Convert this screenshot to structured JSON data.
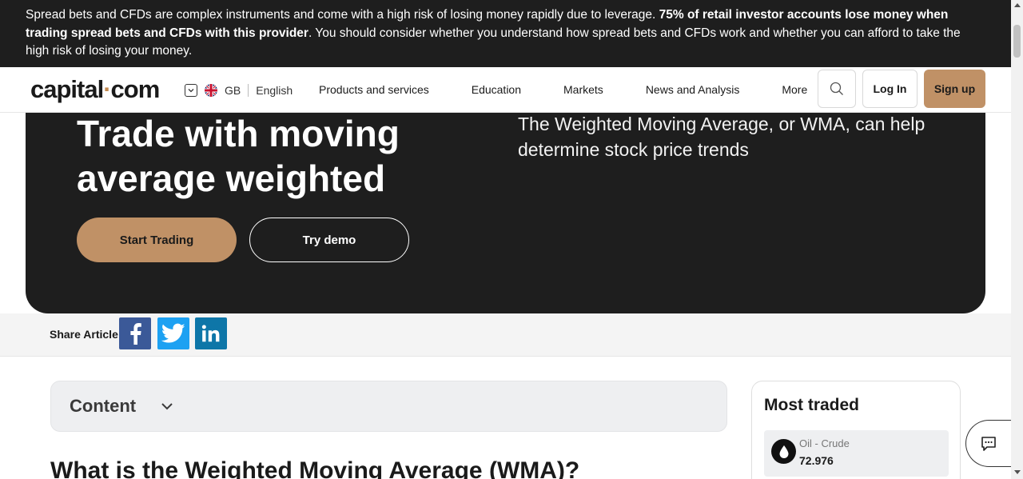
{
  "risk_warning": {
    "text_before": "Spread bets and CFDs are complex instruments and come with a high risk of losing money rapidly due to leverage. ",
    "bold": "75% of retail investor accounts lose money when trading spread bets and CFDs with this provider",
    "text_after": ". You should consider whether you understand how spread bets and CFDs work and whether you can afford to take the high risk of losing your money."
  },
  "header": {
    "logo_main": "capital",
    "logo_dot": "·",
    "logo_end": "com",
    "country": "GB",
    "language": "English",
    "nav": [
      "Products and services",
      "Education",
      "Markets",
      "News and Analysis",
      "More"
    ],
    "login_label": "Log In",
    "signup_label": "Sign up"
  },
  "hero": {
    "title": "Trade with moving average weighted",
    "description": "The Weighted Moving Average, or WMA, can help determine stock price trends",
    "start_label": "Start Trading",
    "demo_label": "Try demo"
  },
  "share": {
    "label": "Share Article",
    "buttons": [
      "facebook",
      "twitter",
      "linkedin"
    ]
  },
  "content": {
    "label": "Content"
  },
  "article": {
    "heading": "What is the Weighted Moving Average (WMA)?"
  },
  "most_traded": {
    "title": "Most traded",
    "items": [
      {
        "name": "Oil - Crude",
        "price": "72.976"
      }
    ]
  },
  "colors": {
    "dark": "#1e1e1e",
    "accent": "#c09166",
    "facebook": "#3b5998",
    "twitter": "#1da1f2",
    "linkedin": "#0e76a8"
  }
}
